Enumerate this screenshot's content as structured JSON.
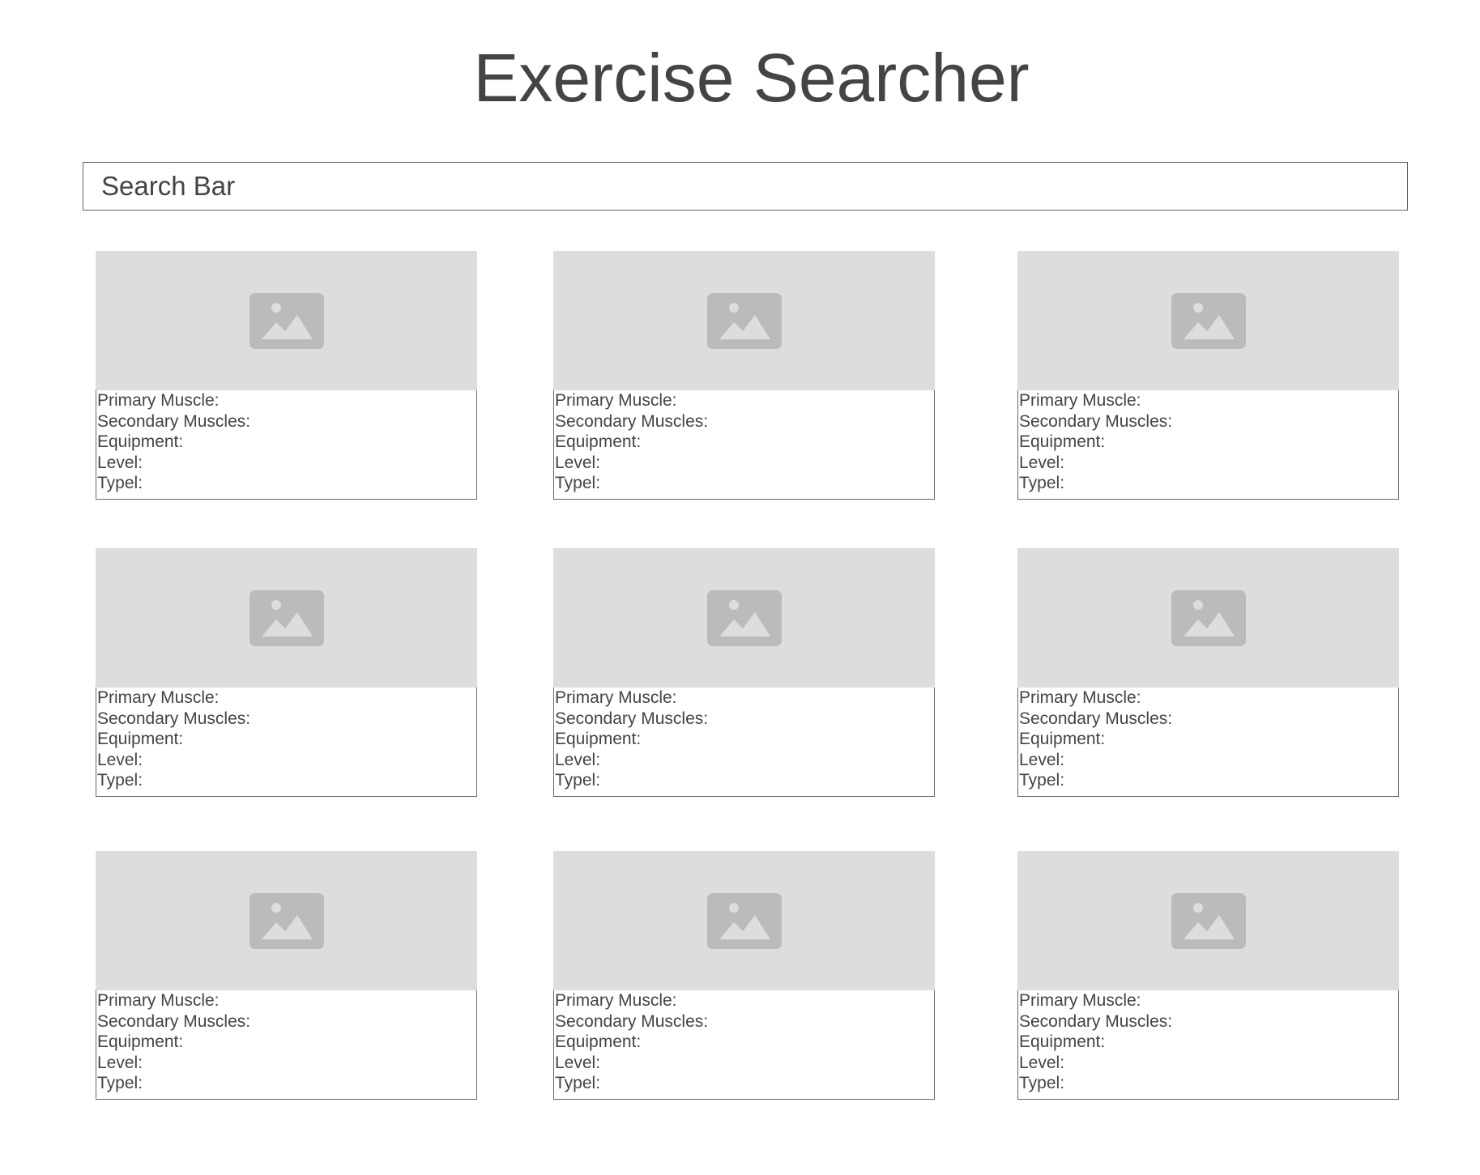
{
  "page": {
    "title": "Exercise Searcher"
  },
  "search": {
    "placeholder": "Search Bar"
  },
  "cards": [
    {
      "primary_label": "Primary Muscle:",
      "secondary_label": "Secondary Muscles:",
      "equipment_label": "Equipment:",
      "level_label": "Level:",
      "type_label": "Typel:",
      "image_icon": "image-placeholder-icon"
    },
    {
      "primary_label": "Primary Muscle:",
      "secondary_label": "Secondary Muscles:",
      "equipment_label": "Equipment:",
      "level_label": "Level:",
      "type_label": "Typel:",
      "image_icon": "image-placeholder-icon"
    },
    {
      "primary_label": "Primary Muscle:",
      "secondary_label": "Secondary Muscles:",
      "equipment_label": "Equipment:",
      "level_label": "Level:",
      "type_label": "Typel:",
      "image_icon": "image-placeholder-icon"
    },
    {
      "primary_label": "Primary Muscle:",
      "secondary_label": "Secondary Muscles:",
      "equipment_label": "Equipment:",
      "level_label": "Level:",
      "type_label": "Typel:",
      "image_icon": "image-placeholder-icon"
    },
    {
      "primary_label": "Primary Muscle:",
      "secondary_label": "Secondary Muscles:",
      "equipment_label": "Equipment:",
      "level_label": "Level:",
      "type_label": "Typel:",
      "image_icon": "image-placeholder-icon"
    },
    {
      "primary_label": "Primary Muscle:",
      "secondary_label": "Secondary Muscles:",
      "equipment_label": "Equipment:",
      "level_label": "Level:",
      "type_label": "Typel:",
      "image_icon": "image-placeholder-icon"
    },
    {
      "primary_label": "Primary Muscle:",
      "secondary_label": "Secondary Muscles:",
      "equipment_label": "Equipment:",
      "level_label": "Level:",
      "type_label": "Typel:",
      "image_icon": "image-placeholder-icon"
    },
    {
      "primary_label": "Primary Muscle:",
      "secondary_label": "Secondary Muscles:",
      "equipment_label": "Equipment:",
      "level_label": "Level:",
      "type_label": "Typel:",
      "image_icon": "image-placeholder-icon"
    },
    {
      "primary_label": "Primary Muscle:",
      "secondary_label": "Secondary Muscles:",
      "equipment_label": "Equipment:",
      "level_label": "Level:",
      "type_label": "Typel:",
      "image_icon": "image-placeholder-icon"
    }
  ],
  "colors": {
    "text": "#444444",
    "image_placeholder_bg": "#dddddd",
    "image_icon": "#bbbbbb",
    "border": "#666666"
  }
}
